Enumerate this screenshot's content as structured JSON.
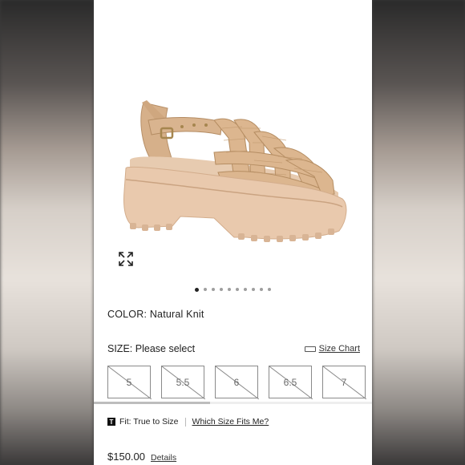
{
  "product": {
    "color_label": "COLOR:",
    "color_value": "Natural Knit",
    "size_label": "SIZE:",
    "size_value": "Please select",
    "size_chart_label": "Size Chart",
    "sizes": [
      "5",
      "5.5",
      "6",
      "6.5",
      "7"
    ],
    "fit_icon_letter": "T",
    "fit_text": "Fit: True to Size",
    "which_size_label": "Which Size Fits Me?",
    "price": "$150.00",
    "details_label": "Details"
  },
  "carousel": {
    "total": 10,
    "active_index": 0
  },
  "colors": {
    "sandal": "#d9b48f",
    "sole": "#e9c9ad",
    "text": "#222222"
  }
}
